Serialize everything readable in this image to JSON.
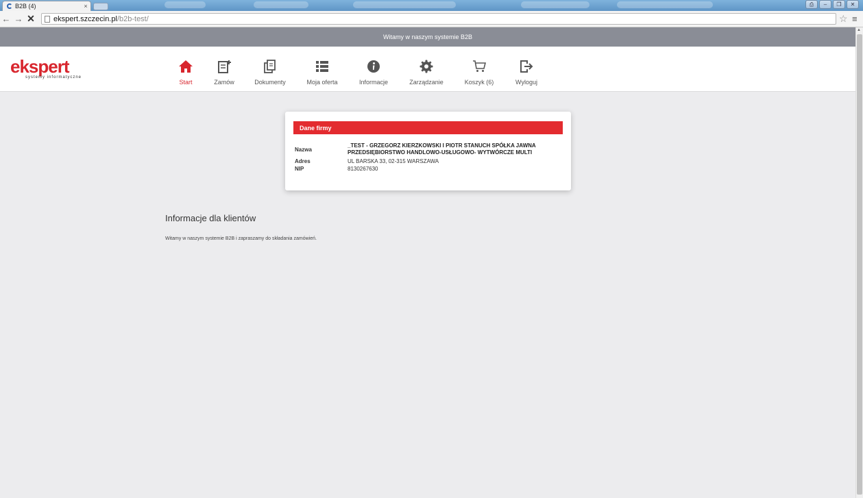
{
  "browser": {
    "tab_title": "B2B (4)",
    "tab_close": "×",
    "url_host": "ekspert.szczecin.pl",
    "url_path": "/b2b-test/",
    "window_buttons": [
      "⎙",
      "–",
      "❐",
      "✕"
    ]
  },
  "page": {
    "welcome": "Witamy w naszym systemie B2B",
    "logo": {
      "main": "ekspert",
      "sub": "systemy informatyczne",
      "color": "#d8262e"
    },
    "nav": [
      {
        "label": "Start",
        "icon": "home-icon",
        "active": true
      },
      {
        "label": "Zamów",
        "icon": "order-icon",
        "active": false
      },
      {
        "label": "Dokumenty",
        "icon": "documents-icon",
        "active": false
      },
      {
        "label": "Moja oferta",
        "icon": "list-icon",
        "active": false
      },
      {
        "label": "Informacje",
        "icon": "info-icon",
        "active": false
      },
      {
        "label": "Zarządzanie",
        "icon": "gear-icon",
        "active": false
      },
      {
        "label": "Koszyk (6)",
        "icon": "cart-icon",
        "active": false
      },
      {
        "label": "Wyloguj",
        "icon": "logout-icon",
        "active": false
      }
    ],
    "company_card": {
      "title": "Dane firmy",
      "name_label": "Nazwa",
      "name_line1": "_TEST - GRZEGORZ KIERZKOWSKI I PIOTR STANUCH SPÓŁKA JAWNA",
      "name_line2": "PRZEDSIĘBIORSTWO HANDLOWO-USŁUGOWO- WYTWÓRCZE MULTI",
      "address_label": "Adres",
      "address": "UL BARSKA 33, 02-315 WARSZAWA",
      "nip_label": "NIP",
      "nip": "8130267630"
    },
    "info": {
      "title": "Informacje dla klientów",
      "text": "Witamy w naszym systemie B2B i zapraszamy do składania zamówień."
    },
    "colors": {
      "accent": "#e32b2f",
      "welcome_bar": "#8a8d96",
      "background": "#ececee"
    }
  }
}
